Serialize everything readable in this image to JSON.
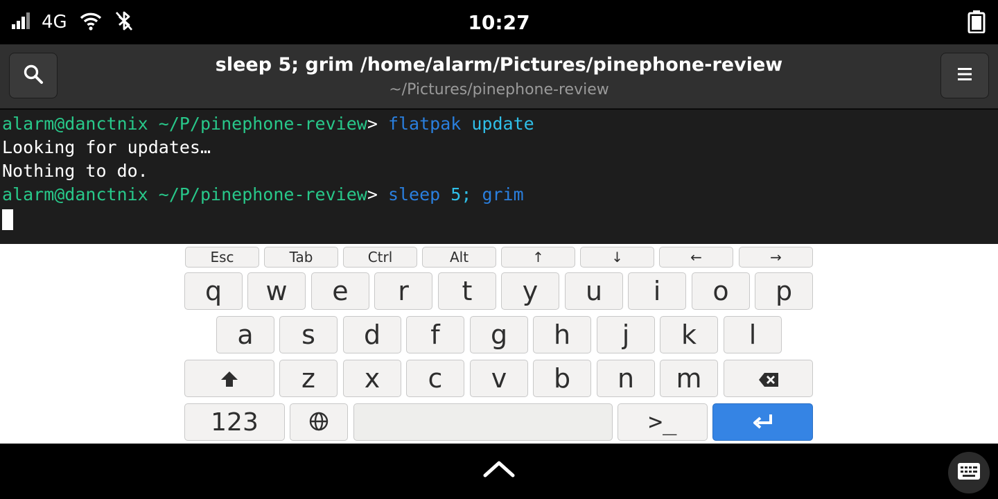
{
  "statusbar": {
    "network_type": "4G",
    "time": "10:27",
    "icons": [
      "signal-icon",
      "wifi-icon",
      "bluetooth-disabled-icon",
      "battery-icon"
    ]
  },
  "header": {
    "title": "sleep 5; grim /home/alarm/Pictures/pinephone-review",
    "subtitle": "~/Pictures/pinephone-review",
    "left_icon": "search-icon",
    "right_icon": "menu-icon"
  },
  "terminal": {
    "prompt_user": "alarm@danctnix",
    "prompt_path": "~/P/pinephone-review",
    "prompt_symbol": ">",
    "cmd1_word1": "flatpak",
    "cmd1_word2": "update",
    "output1": "Looking for updates…",
    "output2": "Nothing to do.",
    "cmd2_word1": "sleep",
    "cmd2_number": "5;",
    "cmd2_word2": "grim"
  },
  "keyboard": {
    "special_row": [
      "Esc",
      "Tab",
      "Ctrl",
      "Alt",
      "↑",
      "↓",
      "←",
      "→"
    ],
    "row1": [
      "q",
      "w",
      "e",
      "r",
      "t",
      "y",
      "u",
      "i",
      "o",
      "p"
    ],
    "row2": [
      "a",
      "s",
      "d",
      "f",
      "g",
      "h",
      "j",
      "k",
      "l"
    ],
    "row3": [
      "z",
      "x",
      "c",
      "v",
      "b",
      "n",
      "m"
    ],
    "numbers_label": "123",
    "terminal_key_label": ">_",
    "enter_color": "#3584e4"
  },
  "colors": {
    "prompt_green": "#28c88a",
    "command_blue": "#2a7fde",
    "argument_cyan": "#2fbfe8",
    "terminal_bg": "#1d1d1d",
    "header_bg": "#303030"
  }
}
